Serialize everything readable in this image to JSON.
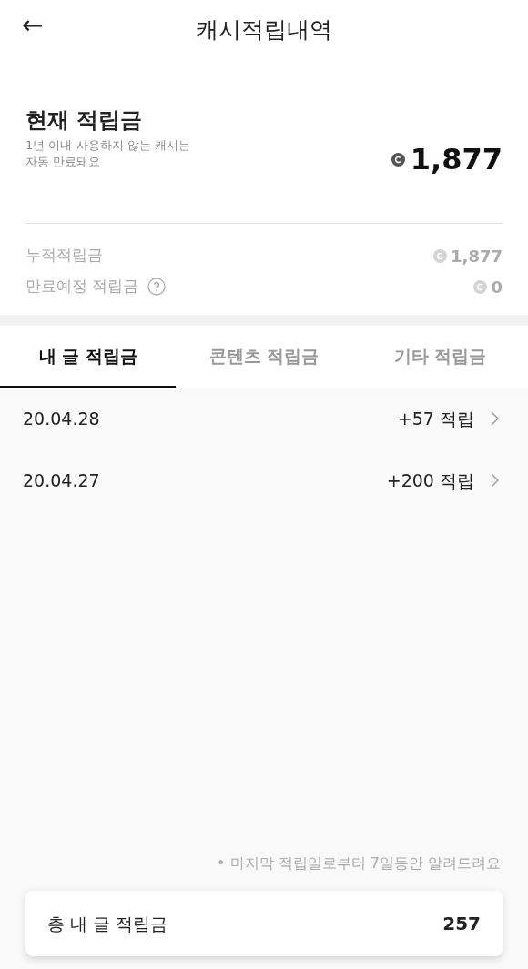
{
  "header": {
    "back": "←",
    "title": "캐시적립내역"
  },
  "balance": {
    "title": "현재 적립금",
    "note_lines": [
      "1년 이내 사용하지 않는 캐시는",
      "자동 만료돼요"
    ],
    "amount": "1,877"
  },
  "details": [
    {
      "label": "누적적립금",
      "amount": "1,877",
      "help": false
    },
    {
      "label": "만료예정 적립금",
      "amount": "0",
      "help": true
    }
  ],
  "tabs": [
    {
      "label": "내 글 적립금",
      "selected": true
    },
    {
      "label": "콘텐츠 적립금",
      "selected": false
    },
    {
      "label": "기타 적립금",
      "selected": false
    }
  ],
  "entries": [
    {
      "date": "20.04.28",
      "amount": "+57 적립"
    },
    {
      "date": "20.04.27",
      "amount": "+200 적립"
    }
  ],
  "footnote": "• 마지막 적립일로부터 7일동안 알려드려요",
  "total": {
    "label": "총 내 글 적립금",
    "value": "257"
  }
}
